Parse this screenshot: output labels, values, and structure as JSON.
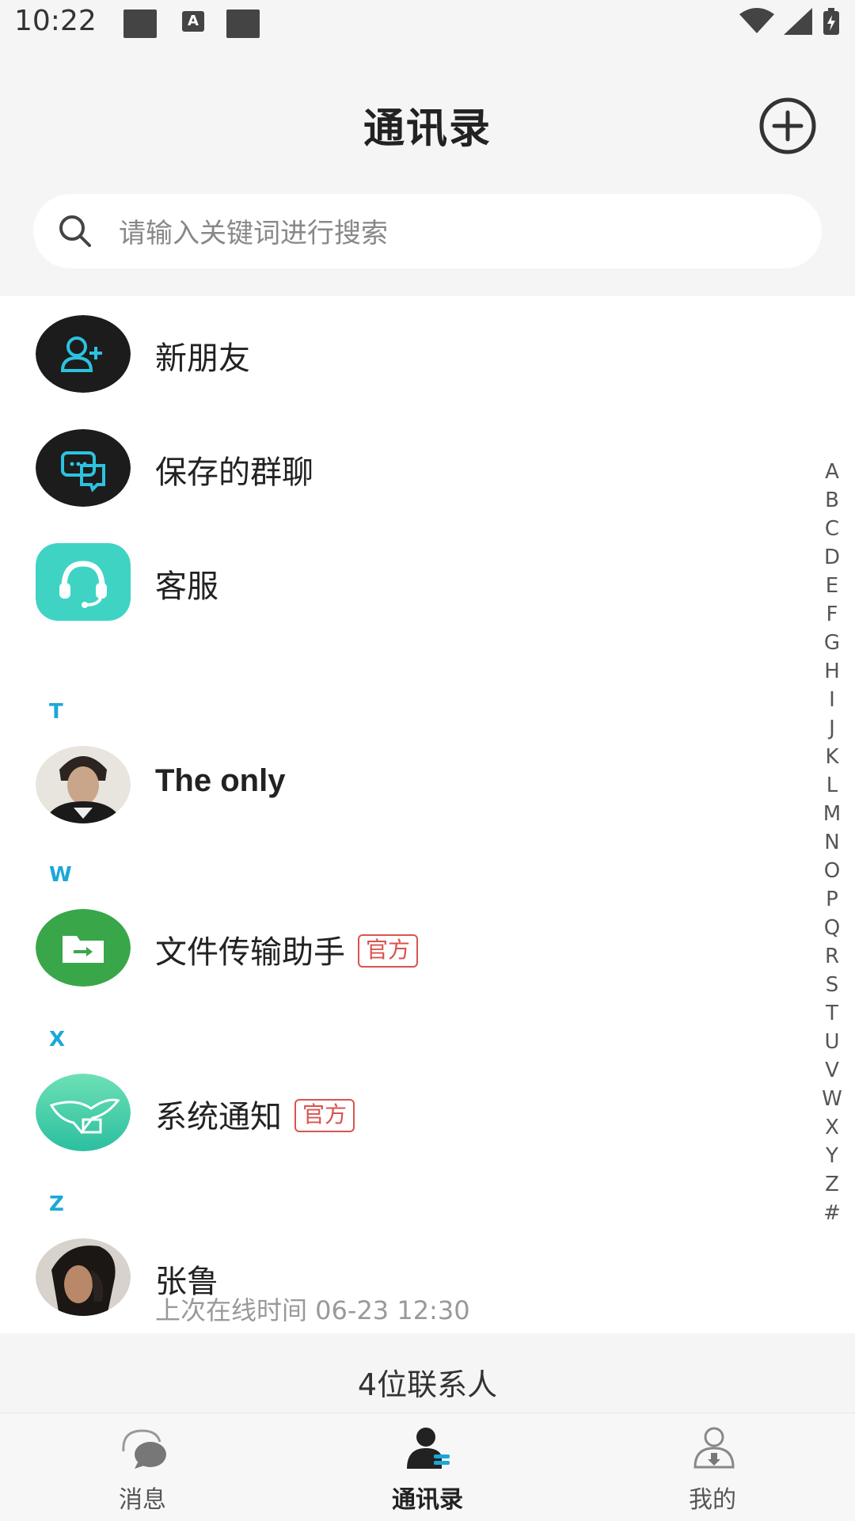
{
  "status_bar": {
    "time": "10:22",
    "a_icon_label": "A"
  },
  "header": {
    "title": "通讯录"
  },
  "search": {
    "placeholder": "请输入关键词进行搜索"
  },
  "top_items": [
    {
      "label": "新朋友",
      "icon": "add-friend-icon"
    },
    {
      "label": "保存的群聊",
      "icon": "group-chat-icon"
    },
    {
      "label": "客服",
      "icon": "customer-service-icon"
    }
  ],
  "sections": [
    {
      "letter": "T",
      "contacts": [
        {
          "name": "The only",
          "avatar": "photo-avatar"
        }
      ]
    },
    {
      "letter": "W",
      "contacts": [
        {
          "name": "文件传输助手",
          "badge": "官方",
          "avatar": "file-transfer-icon"
        }
      ]
    },
    {
      "letter": "X",
      "contacts": [
        {
          "name": "系统通知",
          "badge": "官方",
          "avatar": "system-notice-icon"
        }
      ]
    },
    {
      "letter": "Z",
      "contacts": [
        {
          "name": "张鲁",
          "last_online": "上次在线时间 06-23 12:30",
          "avatar": "photo-avatar"
        }
      ]
    }
  ],
  "alphabet_index": [
    "A",
    "B",
    "C",
    "D",
    "E",
    "F",
    "G",
    "H",
    "I",
    "J",
    "K",
    "L",
    "M",
    "N",
    "O",
    "P",
    "Q",
    "R",
    "S",
    "T",
    "U",
    "V",
    "W",
    "X",
    "Y",
    "Z",
    "#"
  ],
  "footer": {
    "count_text": "4位联系人"
  },
  "tabbar": {
    "tabs": [
      {
        "label": "消息",
        "icon": "messages-icon",
        "active": false
      },
      {
        "label": "通讯录",
        "icon": "contacts-icon",
        "active": true
      },
      {
        "label": "我的",
        "icon": "profile-icon",
        "active": false
      }
    ]
  },
  "colors": {
    "accent": "#1ba8d8",
    "badge": "#d9534f",
    "service": "#3fd3c4",
    "file_green": "#3aa64a"
  }
}
